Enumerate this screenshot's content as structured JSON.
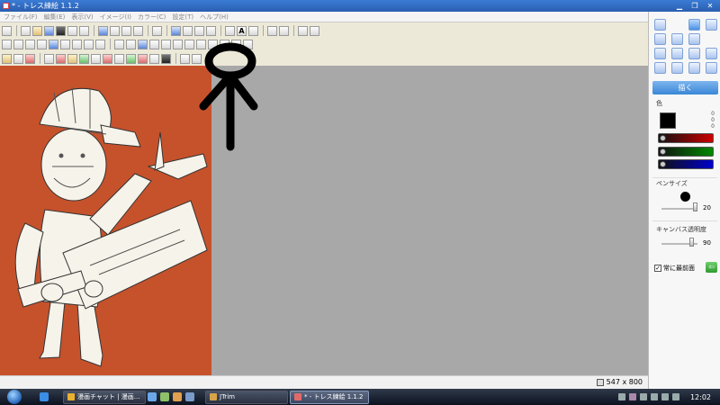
{
  "window": {
    "title": "* - トレス練絵 1.1.2"
  },
  "menu": [
    "ファイル(F)",
    "編集(E)",
    "表示(V)",
    "イメージ(I)",
    "カラー(C)",
    "設定(T)",
    "ヘルプ(H)"
  ],
  "canvas": {
    "size_text": "547 x 800"
  },
  "panel": {
    "draw_label": "描く",
    "color_label": "色",
    "rgb": {
      "r": "0",
      "g": "0",
      "b": "0"
    },
    "pen_size_label": "ペンサイズ",
    "pen_size_value": "20",
    "opacity_label": "キャンバス透明度",
    "opacity_value": "90",
    "always_on_top_label": "常に最前面",
    "colors": {
      "red": "#cc0000",
      "green": "#008800",
      "blue": "#0000cc",
      "canvas_bg": "#c6522b",
      "workspace": "#a8a8a8"
    }
  },
  "taskbar": {
    "tasks": [
      {
        "label": "漫画チャット | 漫画...",
        "active": false
      },
      {
        "label": "JTrim",
        "active": false
      },
      {
        "label": "* - トレス練絵 1.1.2",
        "active": true
      }
    ],
    "clock": "12:02"
  }
}
